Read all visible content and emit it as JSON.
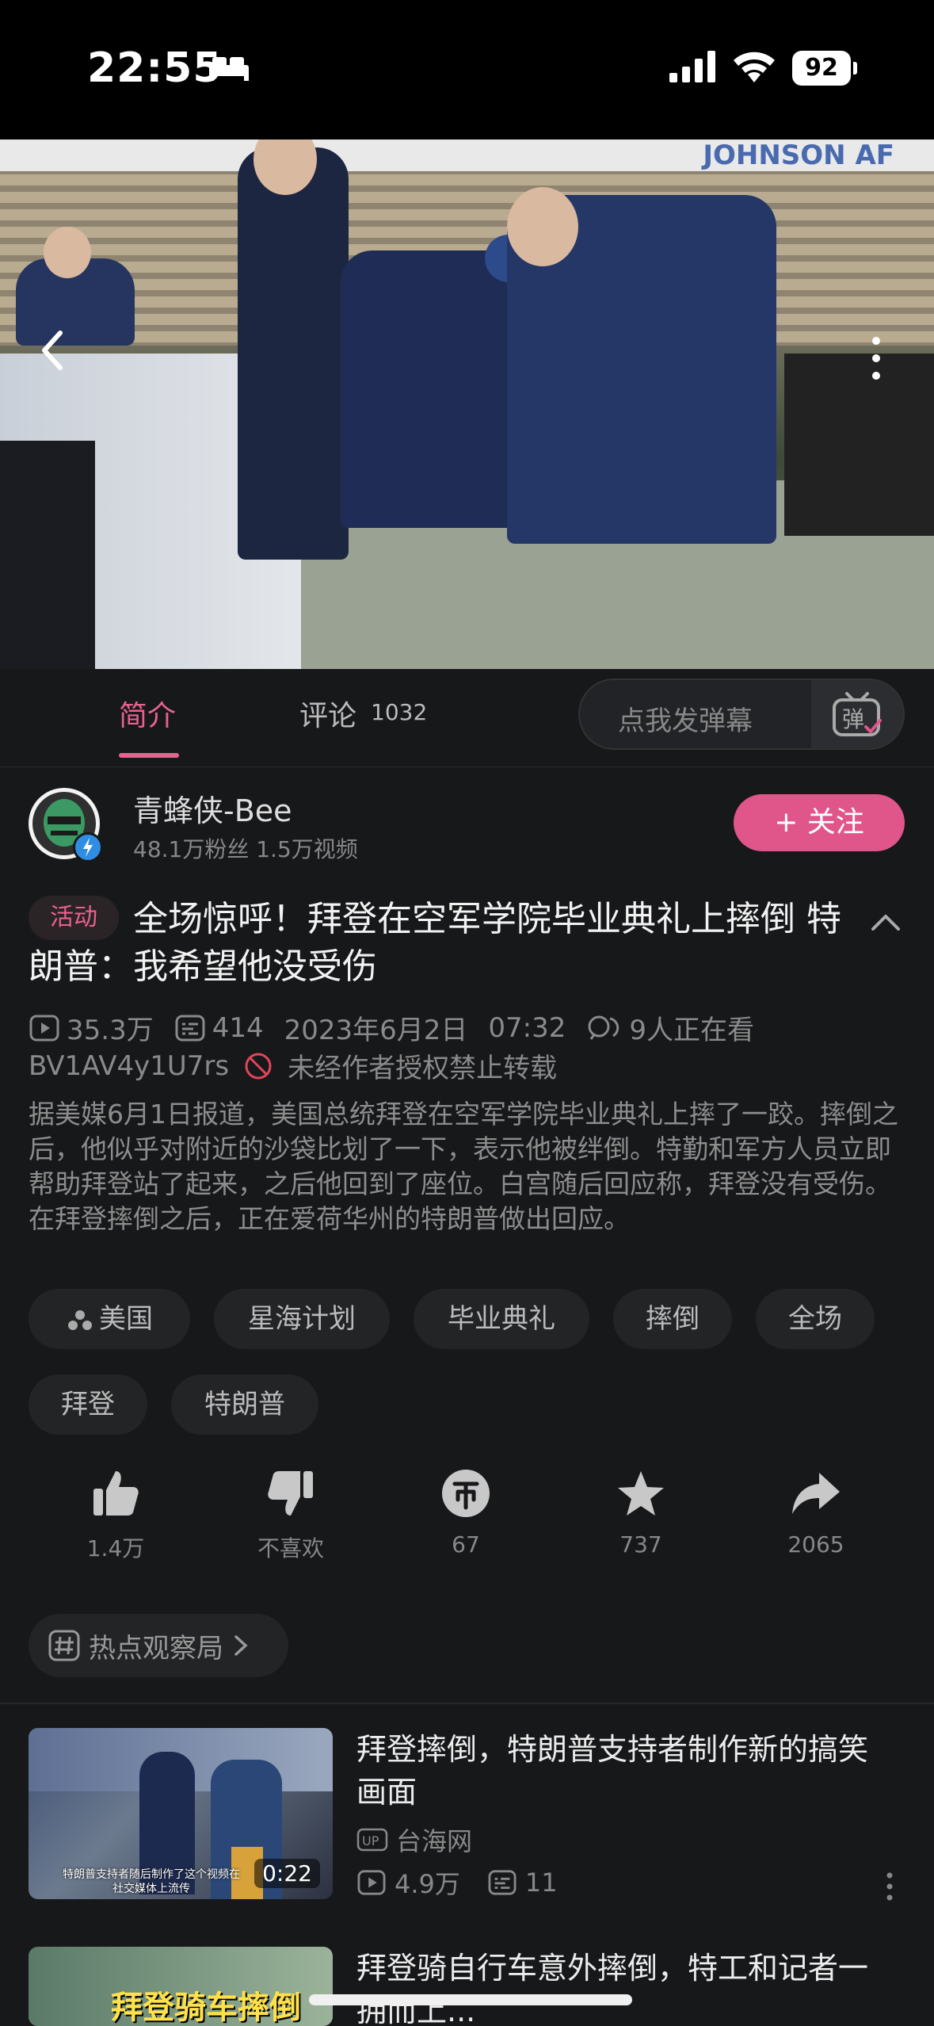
{
  "status_bar": {
    "time": "22:55",
    "battery": "92"
  },
  "tabs": {
    "intro": "简介",
    "comments": "评论",
    "comments_count": "1032"
  },
  "danmaku": {
    "placeholder": "点我发弹幕",
    "button_label": "弹"
  },
  "uploader": {
    "name": "青蜂侠-Bee",
    "meta": "48.1万粉丝  1.5万视频",
    "follow_label": "+ 关注"
  },
  "video": {
    "badge": "活动",
    "title": "全场惊呼！拜登在空军学院毕业典礼上摔倒 特朗普：我希望他没受伤",
    "plays": "35.3万",
    "danmaku_count": "414",
    "date": "2023年6月2日",
    "time": "07:32",
    "watching": "9人正在看",
    "bvid": "BV1AV4y1U7rs",
    "copyright": "未经作者授权禁止转载",
    "description": "据美媒6月1日报道，美国总统拜登在空军学院毕业典礼上摔了一跤。摔倒之后，他似乎对附近的沙袋比划了一下，表示他被绊倒。特勤和军方人员立即帮助拜登站了起来，之后他回到了座位。白宫随后回应称，拜登没有受伤。在拜登摔倒之后，正在爱荷华州的特朗普做出回应。",
    "banner_text": "JOHNSON  AF"
  },
  "tags": [
    "美国",
    "星海计划",
    "毕业典礼",
    "摔倒",
    "全场",
    "拜登",
    "特朗普"
  ],
  "actions": {
    "like": "1.4万",
    "dislike": "不喜欢",
    "coin": "67",
    "favorite": "737",
    "share": "2065"
  },
  "topic": {
    "label": "热点观察局"
  },
  "recommendations": [
    {
      "title": "拜登摔倒，特朗普支持者制作新的搞笑画面",
      "uploader": "台海网",
      "plays": "4.9万",
      "danmaku": "11",
      "duration": "0:22",
      "thumb_caption": "特朗普支持者随后制作了这个视频在社交媒体上流传"
    },
    {
      "title": "拜登骑自行车意外摔倒，特工和记者一拥而上...",
      "thumb_caption": "拜登骑车摔倒"
    }
  ],
  "colors": {
    "accent": "#e0568a",
    "background": "#17181a"
  }
}
